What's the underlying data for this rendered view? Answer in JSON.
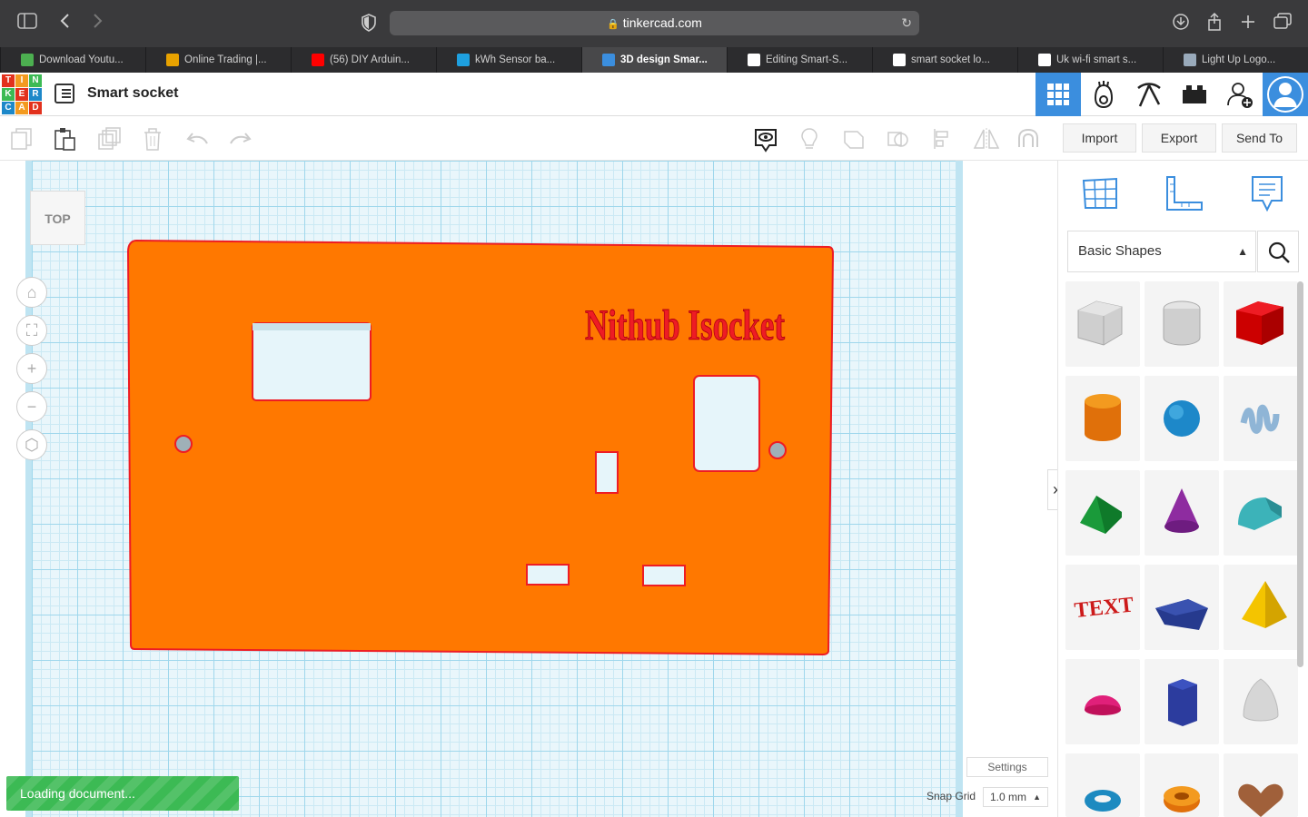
{
  "browser": {
    "url": "tinkercad.com",
    "tabs": [
      {
        "label": "Download Youtu...",
        "color": "#4caf50",
        "active": false
      },
      {
        "label": "Online Trading |...",
        "color": "#e8a200",
        "active": false
      },
      {
        "label": "(56) DIY Arduin...",
        "color": "#ff0000",
        "active": false
      },
      {
        "label": "kWh Sensor ba...",
        "color": "#1ea0e0",
        "active": false
      },
      {
        "label": "3D design Smar...",
        "color": "#3b8ede",
        "active": true
      },
      {
        "label": "Editing Smart-S...",
        "color": "#ffffff",
        "active": false
      },
      {
        "label": "smart socket lo...",
        "color": "#ffffff",
        "active": false
      },
      {
        "label": "Uk wi-fi smart s...",
        "color": "#ffffff",
        "active": false
      },
      {
        "label": "Light Up Logo...",
        "color": "#9ab",
        "active": false
      }
    ]
  },
  "app": {
    "logo_letters": [
      "T",
      "I",
      "N",
      "K",
      "E",
      "R",
      "C",
      "A",
      "D"
    ],
    "logo_colors": [
      "#e2311d",
      "#f39a1f",
      "#3cba54",
      "#3cba54",
      "#e2311d",
      "#1d88c9",
      "#1d88c9",
      "#f39a1f",
      "#e2311d"
    ],
    "design_title": "Smart socket",
    "header_icons": [
      "3d-view-icon",
      "circuit-icon",
      "codeblocks-icon",
      "bricks-icon",
      "invite-user-icon",
      "profile-avatar-icon"
    ]
  },
  "toolbar": {
    "import_label": "Import",
    "export_label": "Export",
    "sendto_label": "Send To"
  },
  "workplane": {
    "viewcube_label": "TOP",
    "model_text": "Nithub Isocket",
    "model_color": "#ff7800",
    "outline_color": "#ee1c24",
    "loading_text": "Loading document...",
    "settings_label": "Settings",
    "snap_grid_label": "Snap Grid",
    "snap_grid_value": "1.0 mm"
  },
  "shape_panel": {
    "category": "Basic Shapes",
    "shapes": [
      "box-hole",
      "cylinder-hole",
      "box",
      "cylinder",
      "sphere",
      "scribble",
      "roof",
      "cone",
      "round-roof",
      "text",
      "wedge",
      "pyramid",
      "half-sphere",
      "polygon",
      "paraboloid",
      "torus",
      "tube",
      "heart"
    ]
  }
}
